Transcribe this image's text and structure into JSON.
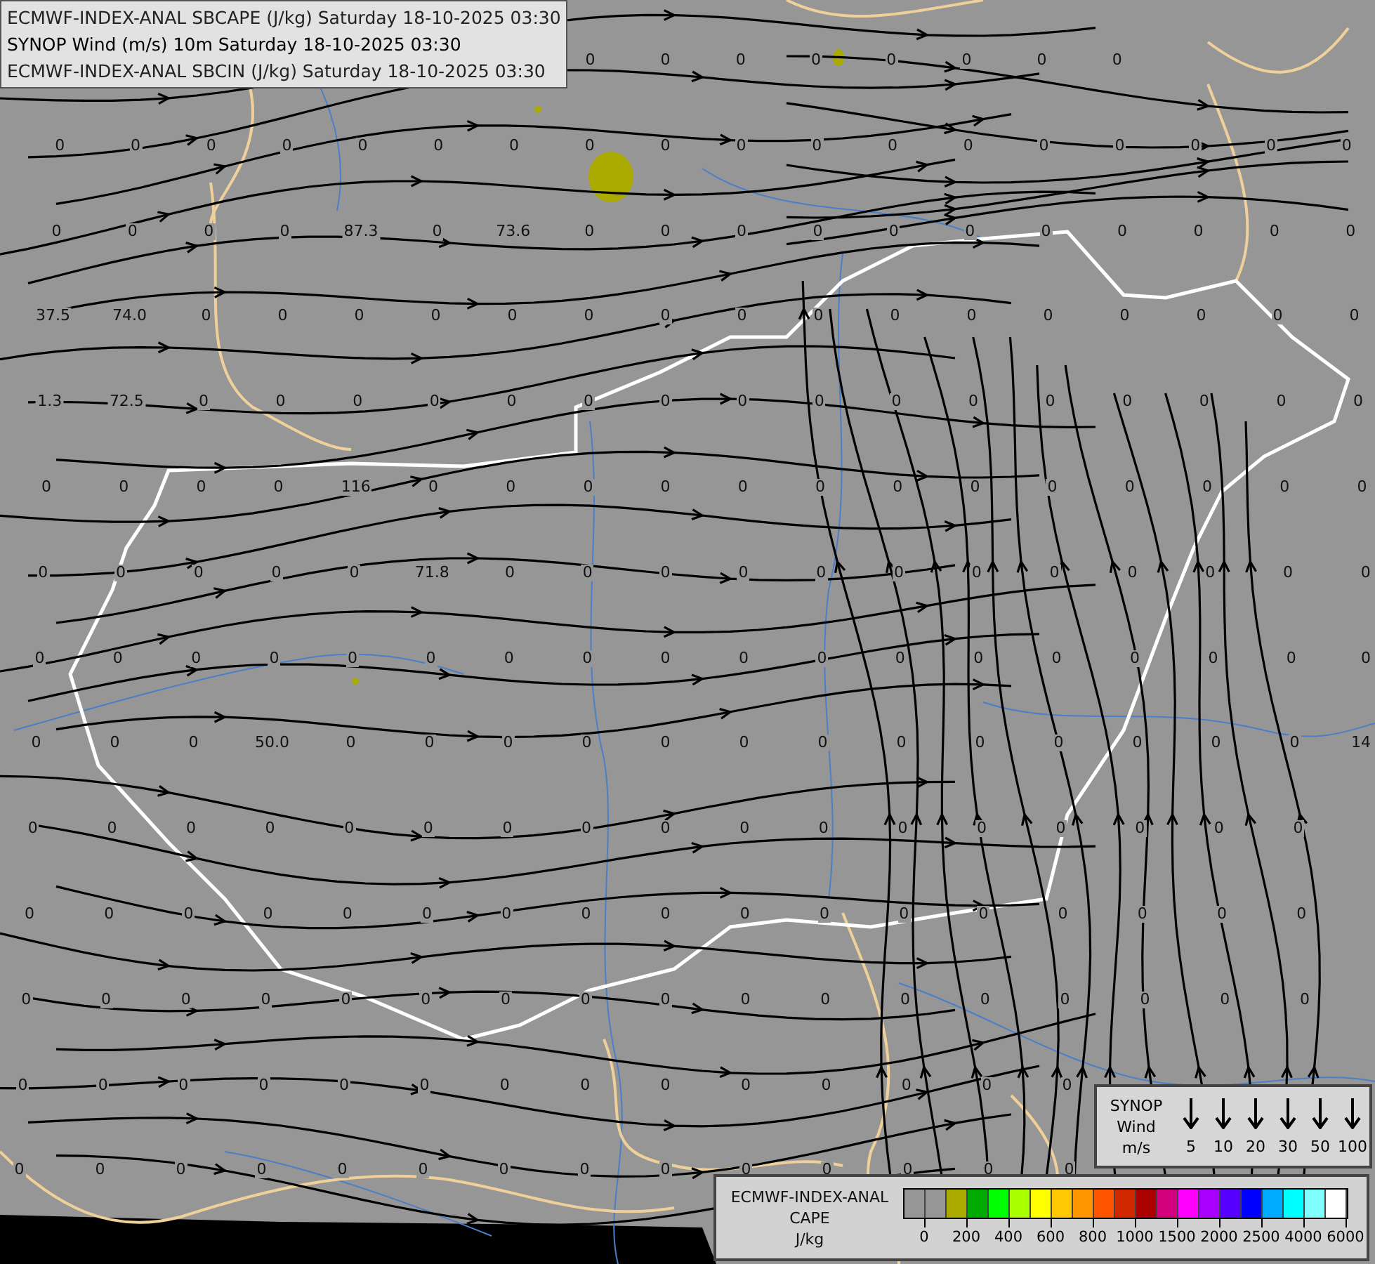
{
  "header": {
    "lines": [
      {
        "text": "ECMWF-INDEX-ANAL SBCAPE (J/kg) Saturday 18-10-2025 03:30",
        "kind": "field"
      },
      {
        "text": "SYNOP Wind (m/s) 10m Saturday 18-10-2025 03:30",
        "kind": "observation"
      },
      {
        "text": "ECMWF-INDEX-ANAL SBCIN (J/kg) Saturday 18-10-2025 03:30",
        "kind": "field"
      }
    ]
  },
  "map": {
    "value_rows": [
      [
        null,
        null,
        null,
        null,
        null,
        null,
        null,
        "0",
        "0",
        "0",
        "0",
        "0",
        "0",
        "0",
        "0"
      ],
      [
        "0",
        "0",
        "0",
        "0",
        "0",
        "0",
        "0",
        "0",
        "0",
        "0",
        "0",
        "0",
        "0",
        "0",
        "0",
        "0",
        "0",
        "0"
      ],
      [
        "0",
        "0",
        "0",
        "0",
        "87.3",
        "0",
        "73.6",
        "0",
        "0",
        "0",
        "0",
        "0",
        "0",
        "0",
        "0",
        "0",
        "0",
        "0"
      ],
      [
        "37.5",
        "74.0",
        "0",
        "0",
        "0",
        "0",
        "0",
        "0",
        "0",
        "0",
        "0",
        "0",
        "0",
        "0",
        "0",
        "0",
        "0",
        "0"
      ],
      [
        "1.3",
        "72.5",
        "0",
        "0",
        "0",
        "0",
        "0",
        "0",
        "0",
        "0",
        "0",
        "0",
        "0",
        "0",
        "0",
        "0",
        "0",
        "0"
      ],
      [
        "0",
        "0",
        "0",
        "0",
        "116",
        "0",
        "0",
        "0",
        "0",
        "0",
        "0",
        "0",
        "0",
        "0",
        "0",
        "0",
        "0",
        "0"
      ],
      [
        "0",
        "0",
        "0",
        "0",
        "0",
        "71.8",
        "0",
        "0",
        "0",
        "0",
        "0",
        "0",
        "0",
        "0",
        "0",
        "0",
        "0",
        "0"
      ],
      [
        "0",
        "0",
        "0",
        "0",
        "0",
        "0",
        "0",
        "0",
        "0",
        "0",
        "0",
        "0",
        "0",
        "0",
        "0",
        "0",
        "0",
        "0"
      ],
      [
        "0",
        "0",
        "0",
        "50.0",
        "0",
        "0",
        "0",
        "0",
        "0",
        "0",
        "0",
        "0",
        "0",
        "0",
        "0",
        "0",
        "0",
        "14"
      ],
      [
        "0",
        "0",
        "0",
        "0",
        "0",
        "0",
        "0",
        "0",
        "0",
        "0",
        "0",
        "0",
        "0",
        "0",
        "0",
        "0",
        "0"
      ],
      [
        "0",
        "0",
        "0",
        "0",
        "0",
        "0",
        "0",
        "0",
        "0",
        "0",
        "0",
        "0",
        "0",
        "0",
        "0",
        "0",
        "0"
      ],
      [
        "0",
        "0",
        "0",
        "0",
        "0",
        "0",
        "0",
        "0",
        "0",
        "0",
        "0",
        "0",
        "0",
        "0",
        "0",
        "0",
        "0"
      ],
      [
        "0",
        "0",
        "0",
        "0",
        "0",
        "0",
        "0",
        "0",
        "0",
        "0",
        "0",
        "0",
        "0",
        "0"
      ],
      [
        "0",
        "0",
        "0",
        "0",
        "0",
        "0",
        "0",
        "0",
        "0",
        "0",
        "0",
        "0",
        "0",
        "0"
      ]
    ]
  },
  "wind_legend": {
    "title_lines": [
      "SYNOP",
      "Wind",
      "m/s"
    ],
    "speeds": [
      "5",
      "10",
      "20",
      "30",
      "50",
      "100"
    ]
  },
  "cape_legend": {
    "title_lines": [
      "ECMWF-INDEX-ANAL",
      "CAPE",
      "J/kg"
    ],
    "swatches": [
      {
        "color": "#969696"
      },
      {
        "color": "#969696"
      },
      {
        "color": "#aaaa00"
      },
      {
        "color": "#00aa00"
      },
      {
        "color": "#00ff00"
      },
      {
        "color": "#aaff00"
      },
      {
        "color": "#ffff00"
      },
      {
        "color": "#ffc800"
      },
      {
        "color": "#ff9600"
      },
      {
        "color": "#ff5500"
      },
      {
        "color": "#d22800"
      },
      {
        "color": "#aa0000"
      },
      {
        "color": "#d2007d"
      },
      {
        "color": "#ff00ff"
      },
      {
        "color": "#aa00ff"
      },
      {
        "color": "#5500ff"
      },
      {
        "color": "#0000ff"
      },
      {
        "color": "#00aaff"
      },
      {
        "color": "#00ffff"
      },
      {
        "color": "#80ffff"
      },
      {
        "color": "#ffffff"
      }
    ],
    "ticks": [
      "0",
      "200",
      "400",
      "600",
      "800",
      "1000",
      "1500",
      "2000",
      "2500",
      "4000",
      "6000"
    ]
  }
}
